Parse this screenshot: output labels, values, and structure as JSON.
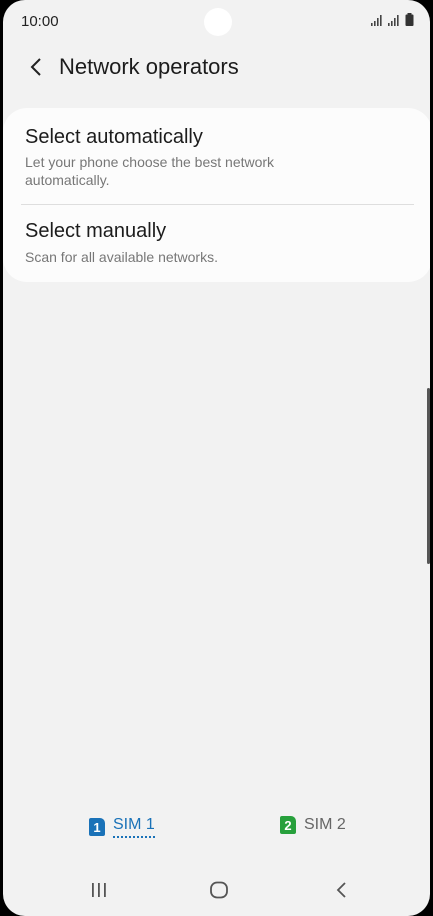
{
  "status_bar": {
    "time": "10:00"
  },
  "header": {
    "title": "Network operators"
  },
  "options": [
    {
      "title": "Select automatically",
      "subtitle": "Let your phone choose the best network automatically."
    },
    {
      "title": "Select manually",
      "subtitle": "Scan for all available networks."
    }
  ],
  "sim_tabs": [
    {
      "badge": "1",
      "label": "SIM 1",
      "color": "#1a72b8",
      "selected": true
    },
    {
      "badge": "2",
      "label": "SIM 2",
      "color": "#27a03c",
      "selected": false
    }
  ],
  "icons": {
    "back": "chevron-left-icon",
    "signal": "signal-icon",
    "battery": "battery-icon",
    "recents": "recent-apps-icon",
    "home": "home-icon",
    "nav_back": "nav-back-icon"
  }
}
